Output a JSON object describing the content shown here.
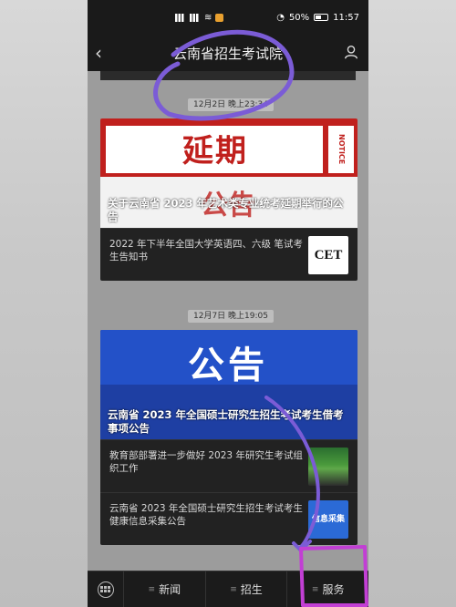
{
  "statusbar": {
    "battery": "50%",
    "time": "11:57"
  },
  "navbar": {
    "back_icon": "chevron-left-icon",
    "title": "云南省招生考试院",
    "user_icon": "user-icon"
  },
  "feed": {
    "groups": [
      {
        "timestamp": "12月2日 晚上23:34",
        "banner_text_big": "延期",
        "banner_text_notice": "NOTICE",
        "banner_text_sub": "公告",
        "headline": "关于云南省 2023 年艺术类专业统考延期举行的公告",
        "items": [
          {
            "text": "2022 年下半年全国大学英语四、六级 笔试考生告知书",
            "thumb": "CET"
          }
        ]
      },
      {
        "timestamp": "12月7日 晚上19:05",
        "banner_text_big": "公告",
        "headline": "云南省 2023 年全国硕士研究生招生考试考生借考事项公告",
        "items": [
          {
            "text": "教育部部署进一步做好 2023 年研究生考试组织工作",
            "thumb": "photo"
          },
          {
            "text": "云南省 2023 年全国硕士研究生招生考试考生健康信息采集公告",
            "thumb": "信息采集"
          }
        ]
      }
    ]
  },
  "tabbar": {
    "keyboard_icon": "keyboard-icon",
    "tabs": [
      {
        "label": "新闻"
      },
      {
        "label": "招生"
      },
      {
        "label": "服务"
      }
    ]
  },
  "colors": {
    "annotation": "#7b5cd6",
    "banner_red": "#c0201d",
    "banner_blue": "#2351c8"
  }
}
